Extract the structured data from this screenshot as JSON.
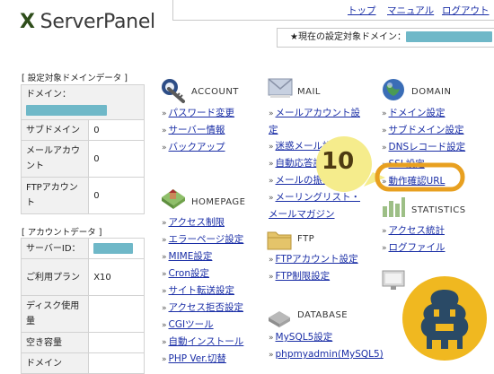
{
  "app": {
    "logo_mark": "X",
    "logo_text": "ServerPanel"
  },
  "topnav": {
    "links": [
      "トップ",
      "マニュアル",
      "ログアウト"
    ]
  },
  "domain_bar": {
    "label": "★現在の設定対象ドメイン："
  },
  "domain_data": {
    "title": "[ 設定対象ドメインデータ ]",
    "rows": [
      {
        "key": "ドメイン：",
        "value": ""
      },
      {
        "key": "サブドメイン",
        "value": "0"
      },
      {
        "key": "メールアカウント",
        "value": "0"
      },
      {
        "key": "FTPアカウント",
        "value": "0"
      }
    ]
  },
  "account_data": {
    "title": "[ アカウントデータ ]",
    "rows": [
      {
        "key": "サーバーID：",
        "value": ""
      },
      {
        "key": "ご利用プラン",
        "value": "X10"
      },
      {
        "key": "ディスク使用量",
        "value": ""
      },
      {
        "key": "空き容量",
        "value": ""
      },
      {
        "key": "ドメイン",
        "value": ""
      }
    ]
  },
  "menus": {
    "account": {
      "title": "ACCOUNT",
      "items": [
        "パスワード変更",
        "サーバー情報",
        "バックアップ"
      ]
    },
    "homepage": {
      "title": "HOMEPAGE",
      "items": [
        "アクセス制限",
        "エラーページ設定",
        "MIME設定",
        "Cron設定",
        "サイト転送設定",
        "アクセス拒否設定",
        "CGIツール",
        "自動インストール",
        "PHP Ver.切替"
      ]
    },
    "mail": {
      "title": "MAIL",
      "items": [
        "メールアカウント設定",
        "迷惑メール設定",
        "自動応答設定",
        "メールの振分け",
        "メーリングリスト・メールマガジン"
      ]
    },
    "ftp": {
      "title": "FTP",
      "items": [
        "FTPアカウント設定",
        "FTP制限設定"
      ]
    },
    "database": {
      "title": "DATABASE",
      "items": [
        "MySQL5設定",
        "phpmyadmin(MySQL5)"
      ]
    },
    "domain": {
      "title": "DOMAIN",
      "items": [
        "ドメイン設定",
        "サブドメイン設定",
        "DNSレコード設定",
        "SSL設定",
        "動作確認URL"
      ]
    },
    "statistics": {
      "title": "STATISTICS",
      "items": [
        "アクセス統計",
        "ログファイル"
      ]
    }
  },
  "annotation": {
    "number": "10"
  },
  "colors": {
    "link": "#1a2ea6",
    "highlight": "#e8a020",
    "mask": "#6fb8c8",
    "mascot": "#f0b820"
  }
}
